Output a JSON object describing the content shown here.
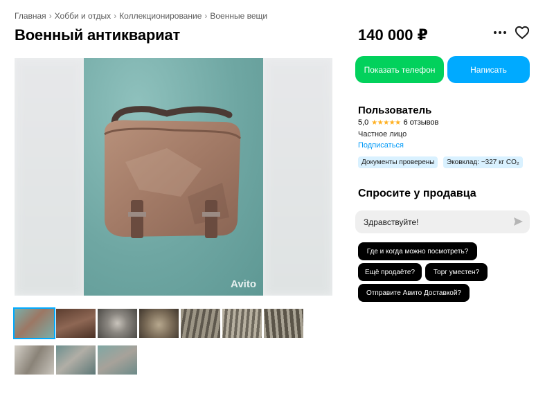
{
  "breadcrumb": {
    "items": [
      "Главная",
      "Хобби и отдых",
      "Коллекционирование",
      "Военные вещи"
    ],
    "separator": "›"
  },
  "listing": {
    "title": "Военный антиквариат",
    "price": "140 000 ₽"
  },
  "gallery": {
    "watermark": "Avito",
    "main_photo": "brown-leather-bag",
    "thumbnail_count": 10,
    "active_thumbnail": 1
  },
  "actions": {
    "show_phone": "Показать телефон",
    "write": "Написать",
    "more_icon": "ellipsis-icon",
    "favorite_icon": "heart-icon"
  },
  "seller": {
    "name": "Пользователь",
    "rating": "5,0",
    "reviews": "6 отзывов",
    "type": "Частное лицо",
    "subscribe": "Подписаться",
    "badges": {
      "docs": "Документы проверены",
      "eco": "Эковклад: −327 кг CO₂"
    }
  },
  "ask": {
    "title": "Спросите у продавца",
    "input_value": "Здравствуйте!",
    "chips": [
      "Где и когда можно посмотреть?",
      "Ещё продаёте?",
      "Торг уместен?",
      "Отправите Авито Доставкой?"
    ]
  },
  "colors": {
    "phone_button": "#02d15c",
    "write_button": "#00aaff",
    "link": "#0099f7",
    "badge_bg": "#d9f1ff",
    "chip_bg": "#000000",
    "star": "#ffb021"
  }
}
